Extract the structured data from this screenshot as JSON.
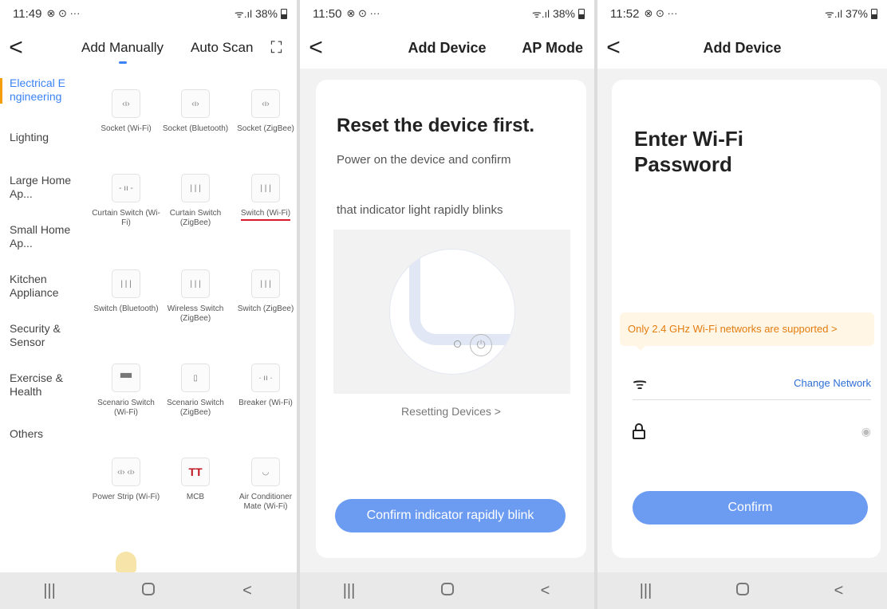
{
  "screen1": {
    "status": {
      "time": "11:49",
      "extra": "⊗ ⊙ ···",
      "signal": "ᯤ.ıl",
      "battery": "38%"
    },
    "tabs": {
      "add_manually": "Add Manually",
      "auto_scan": "Auto Scan"
    },
    "back_glyph": "<",
    "scan_glyph": "⛶",
    "sidebar": [
      {
        "label": "Electrical E ngineering"
      },
      {
        "label": "Lighting"
      },
      {
        "label": "Large Home Ap..."
      },
      {
        "label": "Small Home Ap..."
      },
      {
        "label": "Kitchen Appliance"
      },
      {
        "label": "Security & Sensor"
      },
      {
        "label": "Exercise & Health"
      },
      {
        "label": "Others"
      }
    ],
    "devices": [
      {
        "label": "Socket (Wi-Fi)",
        "glyph": "‹ı›"
      },
      {
        "label": "Socket (Bluetooth)",
        "glyph": "‹ı›"
      },
      {
        "label": "Socket (ZigBee)",
        "glyph": "‹ı›"
      },
      {
        "label": "Curtain Switch (Wi-Fi)",
        "glyph": "- ıı -"
      },
      {
        "label": "Curtain Switch (ZigBee)",
        "glyph": "| | |"
      },
      {
        "label": "Switch (Wi-Fi)",
        "glyph": "| | |"
      },
      {
        "label": "Switch (Bluetooth)",
        "glyph": "| | |"
      },
      {
        "label": "Wireless Switch (ZigBee)",
        "glyph": "| | |"
      },
      {
        "label": "Switch (ZigBee)",
        "glyph": "| | |"
      },
      {
        "label": "Scenario Switch (Wi-Fi)",
        "glyph": "▀▀"
      },
      {
        "label": "Scenario Switch (ZigBee)",
        "glyph": "▯"
      },
      {
        "label": "Breaker (Wi-Fi)",
        "glyph": "∙ ıı ∙"
      },
      {
        "label": "Power Strip (Wi-Fi)",
        "glyph": "‹ı› ‹ı›"
      },
      {
        "label": "MCB",
        "glyph": "TT"
      },
      {
        "label": "Air Conditioner Mate (Wi-Fi)",
        "glyph": "◡"
      }
    ],
    "nav_buttons": {
      "recents": "|||",
      "home": "",
      "back": "<"
    }
  },
  "screen2": {
    "status": {
      "time": "11:50",
      "extra": "⊗ ⊙ ···",
      "signal": "ᯤ.ıl",
      "battery": "38%"
    },
    "title": "Add Device",
    "right_action": "AP Mode",
    "back_glyph": "<",
    "heading": "Reset the device first.",
    "instruction_line1": "Power on the device and confirm",
    "instruction_line2": "that indicator light rapidly blinks",
    "power_glyph": "⏻",
    "resetting_link": "Resetting Devices  >",
    "confirm_button": "Confirm indicator rapidly blink",
    "nav_buttons": {
      "recents": "|||",
      "home": "",
      "back": "<"
    }
  },
  "screen3": {
    "status": {
      "time": "11:52",
      "extra": "⊗ ⊙ ···",
      "signal": "ᯤ.ıl",
      "battery": "37%"
    },
    "title": "Add Device",
    "back_glyph": "<",
    "heading": "Enter Wi-Fi Password",
    "notice": "Only 2.4 GHz Wi-Fi networks are supported  >",
    "wifi_glyph": "ᯤ",
    "change_network": "Change Network",
    "eye_glyph": "◉",
    "confirm_button": "Confirm",
    "nav_buttons": {
      "recents": "|||",
      "home": "",
      "back": "<"
    }
  },
  "colors": {
    "accent": "#3b82f6",
    "button": "#6c9bf2",
    "notice_text": "#e37c0e",
    "notice_bg": "#fff6e5",
    "underline": "#d81b2c",
    "side_marker": "#f59e0b"
  }
}
